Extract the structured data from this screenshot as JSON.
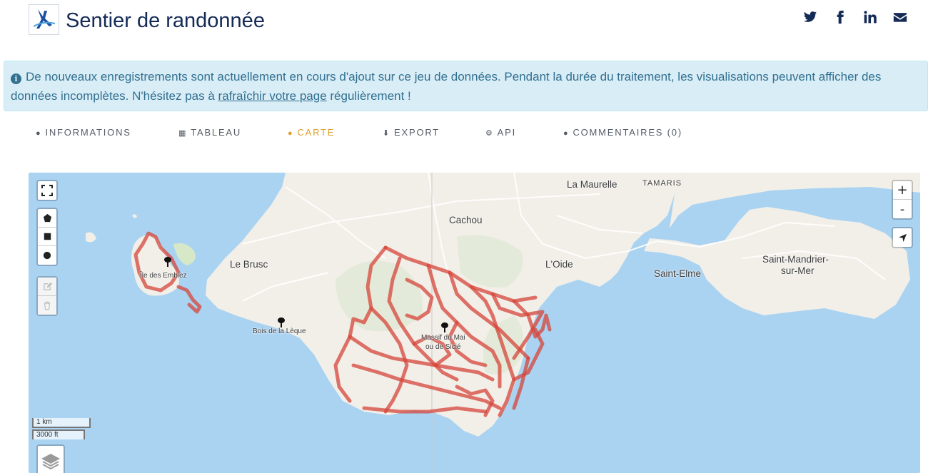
{
  "header": {
    "title": "Sentier de randonnée",
    "social": [
      {
        "name": "twitter-icon"
      },
      {
        "name": "facebook-icon"
      },
      {
        "name": "linkedin-icon"
      },
      {
        "name": "email-icon"
      }
    ]
  },
  "alert": {
    "text_before": "De nouveaux enregistrements sont actuellement en cours d'ajout sur ce jeu de données. Pendant la durée du traitement, les visualisations peuvent afficher des données incomplètes. N'hésitez pas à ",
    "link": "rafraîchir votre page",
    "text_after": " régulièrement !"
  },
  "tabs": [
    {
      "label": "INFORMATIONS",
      "icon": "info-icon",
      "active": false
    },
    {
      "label": "TABLEAU",
      "icon": "table-icon",
      "active": false
    },
    {
      "label": "CARTE",
      "icon": "globe-icon",
      "active": true
    },
    {
      "label": "EXPORT",
      "icon": "download-icon",
      "active": false
    },
    {
      "label": "API",
      "icon": "gears-icon",
      "active": false
    },
    {
      "label": "COMMENTAIRES (0)",
      "icon": "comments-icon",
      "active": false
    }
  ],
  "map": {
    "places": {
      "la_maurelle": "La Maurelle",
      "tamaris": "TAMARIS",
      "cachou": "Cachou",
      "le_brusc": "Le Brusc",
      "loide": "L'Oide",
      "saint_elme": "Saint-Elme",
      "saint_mandrier_1": "Saint-Mandrier-",
      "saint_mandrier_2": "sur-Mer",
      "ile_embiez": "Île des Embiez",
      "bois_leque": "Bois de la Lèque",
      "massif_1": "Massif du Mai",
      "massif_2": "ou de Sicié"
    },
    "scale": {
      "metric": "1 km",
      "imperial": "3000 ft"
    },
    "zoom": {
      "in": "+",
      "out": "-"
    },
    "colors": {
      "water": "#aad3f2",
      "land": "#f2efe9",
      "trail": "#d6453a"
    }
  }
}
